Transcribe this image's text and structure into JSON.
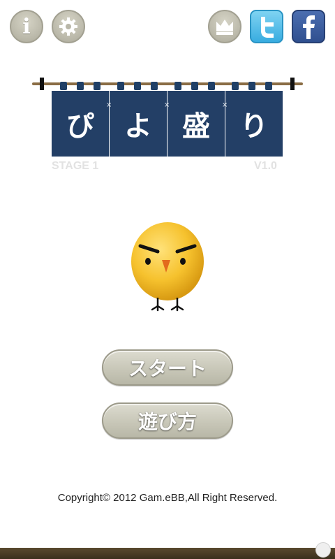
{
  "header": {
    "icons": {
      "info": "info-icon",
      "settings": "gear-icon",
      "ranking": "crown-icon",
      "twitter": "twitter-icon",
      "facebook": "facebook-icon"
    },
    "info_glyph": "i"
  },
  "title": {
    "chars": [
      "ぴ",
      "よ",
      "盛",
      "り"
    ],
    "stage": "STAGE 1",
    "version": "V1.0"
  },
  "menu": {
    "start_label": "スタート",
    "howto_label": "遊び方"
  },
  "footer": {
    "copyright": "Copyright© 2012 Gam.eBB,All Right Reserved."
  },
  "colors": {
    "noren": "#233f66",
    "button": "#c8c7b8",
    "chick": "#f2c233"
  }
}
